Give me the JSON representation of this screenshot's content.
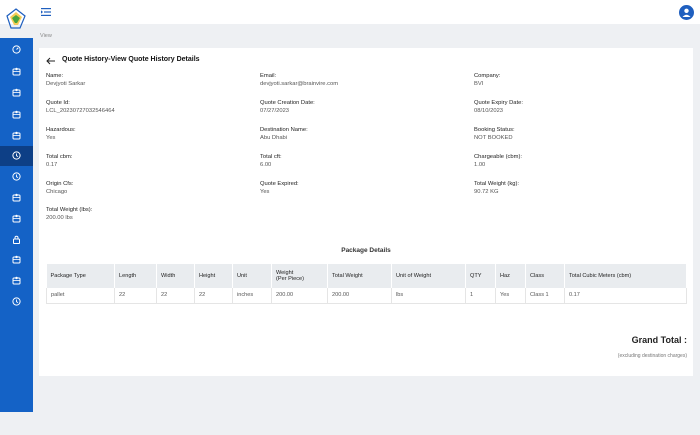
{
  "breadcrumb": "View",
  "page_title": "Quote History-View Quote History Details",
  "fields": [
    {
      "label": "Name:",
      "value": "Devjyoti Sarkar"
    },
    {
      "label": "Email:",
      "value": "devjyoti.sarkar@brainvire.com"
    },
    {
      "label": "Company:",
      "value": "BVI"
    },
    {
      "label": "Quote Id:",
      "value": "LCL_20230727032546464"
    },
    {
      "label": "Quote Creation Date:",
      "value": "07/27/2023"
    },
    {
      "label": "Quote Expiry Date:",
      "value": "08/10/2023"
    },
    {
      "label": "Hazardous:",
      "value": "Yes"
    },
    {
      "label": "Destination Name:",
      "value": "Abu Dhabi"
    },
    {
      "label": "Booking Status:",
      "value": "NOT BOOKED"
    },
    {
      "label": "Total cbm:",
      "value": "0.17"
    },
    {
      "label": "Total cft:",
      "value": "6.00"
    },
    {
      "label": "Chargeable (cbm):",
      "value": "1.00"
    },
    {
      "label": "Origin Cfs:",
      "value": "Chicago"
    },
    {
      "label": "Quote Expired:",
      "value": "Yes"
    },
    {
      "label": "Total Weight (kg):",
      "value": "90.72 KG"
    },
    {
      "label": "Total Weight (lbs):",
      "value": "200.00 lbs"
    }
  ],
  "package_details": {
    "title": "Package Details",
    "columns": [
      "Package Type",
      "Length",
      "Width",
      "Height",
      "Unit",
      "Weight (Per Piece)",
      "Total Weight",
      "Unit of Weight",
      "QTY",
      "Haz",
      "Class",
      "Total Cubic Meters (cbm)"
    ],
    "weight_header_line1": "Weight",
    "weight_header_line2": "(Per Piece)",
    "rows": [
      [
        "pallet",
        "22",
        "22",
        "22",
        "inches",
        "200.00",
        "200.00",
        "lbs",
        "1",
        "Yes",
        "Class 1",
        "0.17"
      ]
    ]
  },
  "grand_total_label": "Grand Total :",
  "grand_total_note": "(excluding destination charges)",
  "colors": {
    "sidebar": "#1462c6",
    "sidebar_active": "#0d3f86",
    "accent": "#1f5fbf"
  },
  "icons": {
    "sidebar": [
      "dashboard-icon",
      "package-icon",
      "package-icon",
      "package-icon",
      "package-icon",
      "history-icon",
      "history-icon",
      "package-icon",
      "package-icon",
      "lock-icon",
      "package-icon",
      "package-icon",
      "history-icon"
    ]
  }
}
